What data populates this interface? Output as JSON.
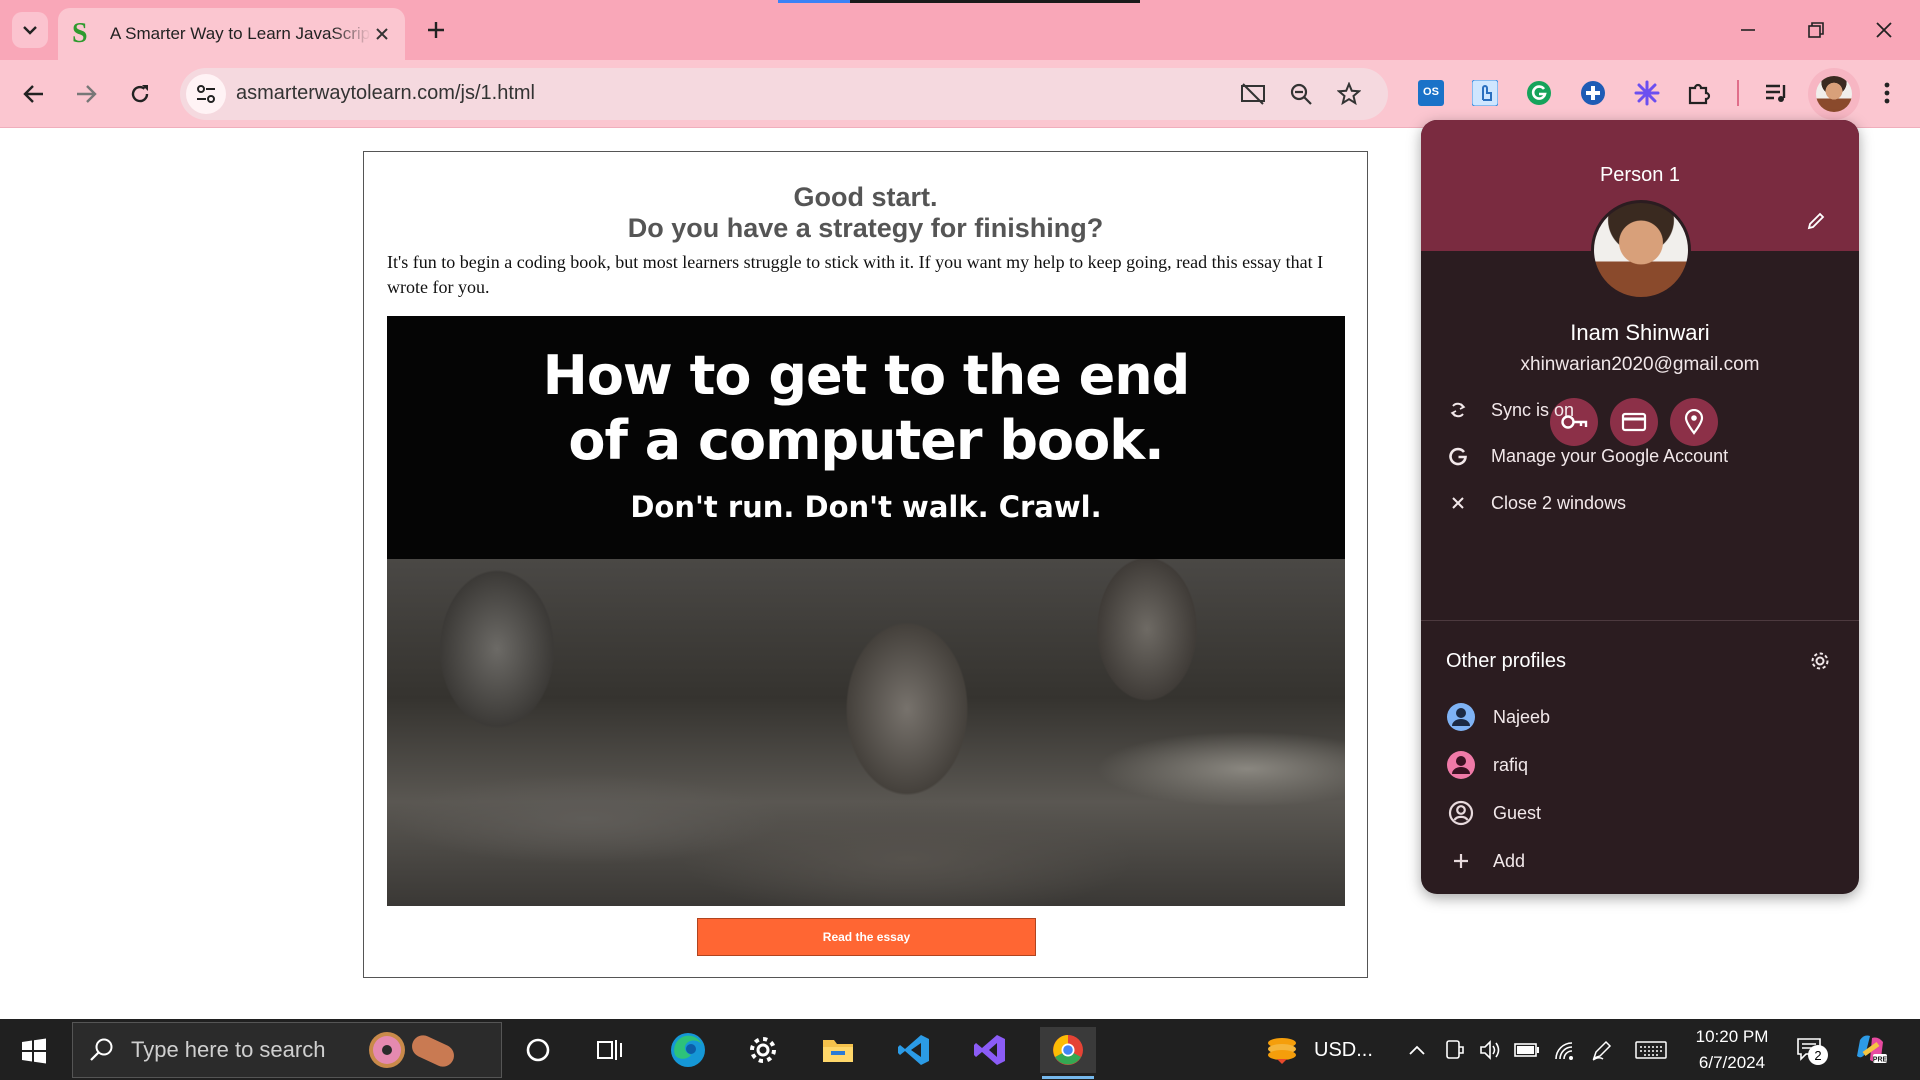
{
  "browser": {
    "tab_title": "A Smarter Way to Learn JavaScript",
    "tab_favicon": "S",
    "url": "asmarterwaytolearn.com/js/1.html"
  },
  "page": {
    "heading_1": "Good start.",
    "heading_2": "Do you have a strategy for finishing?",
    "intro": "It's fun to begin a coding book, but most learners struggle to stick with it. If you want my help to keep going, read this essay that I wrote for you.",
    "banner_line_1": "How to get to the end",
    "banner_line_2": "of a computer book.",
    "banner_subline": "Don't run. Don't walk. Crawl.",
    "cta_label": "Read the essay",
    "accent_color": "#ff6633"
  },
  "profile_menu": {
    "title": "Person 1",
    "account_name": "Inam Shinwari",
    "account_email": "xhinwarian2020@gmail.com",
    "quick_actions": [
      "passwords-icon",
      "payment-methods-icon",
      "addresses-icon"
    ],
    "items": [
      {
        "icon": "sync-icon",
        "label": "Sync is on"
      },
      {
        "icon": "google-icon",
        "label": "Manage your Google Account"
      },
      {
        "icon": "close-icon",
        "label": "Close 2 windows"
      }
    ],
    "other_profiles_title": "Other profiles",
    "profiles": [
      {
        "icon": "person-icon",
        "label": "Najeeb",
        "color": "#7fb3f5"
      },
      {
        "icon": "person-icon",
        "label": "rafiq",
        "color": "#f07aa8"
      },
      {
        "icon": "guest-icon",
        "label": "Guest",
        "color": "#e8dadd"
      },
      {
        "icon": "add-icon",
        "label": "Add",
        "color": "#e8dadd"
      }
    ],
    "header_color": "#7a2b40",
    "background_color": "#2b1c20"
  },
  "taskbar": {
    "search_placeholder": "Type here to search",
    "weather_text": "USD...",
    "time": "10:20 PM",
    "date": "6/7/2024",
    "notification_count": "2"
  }
}
